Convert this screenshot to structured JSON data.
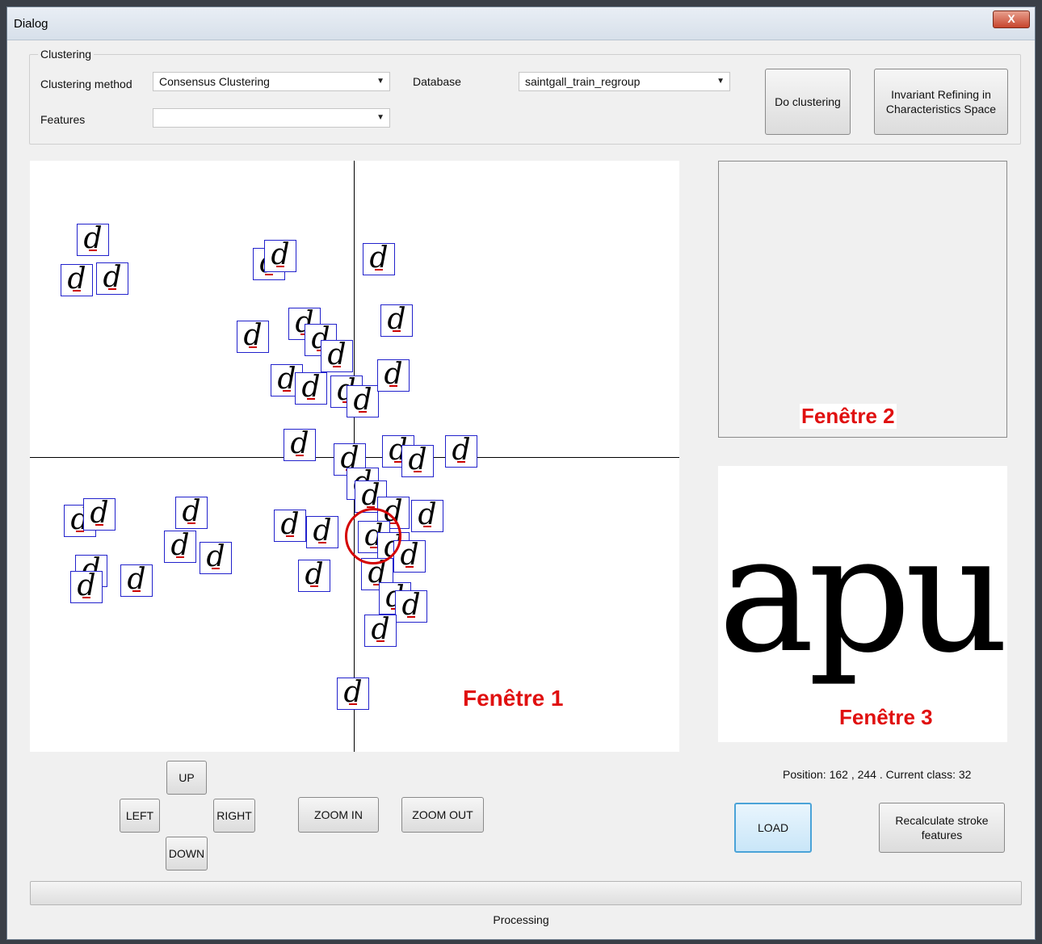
{
  "window": {
    "title": "Dialog",
    "close_label": "X"
  },
  "clustering": {
    "group_title": "Clustering",
    "method_label": "Clustering method",
    "method_value": "Consensus Clustering",
    "database_label": "Database",
    "database_value": "saintgall_train_regroup",
    "features_label": "Features",
    "features_value": "",
    "do_clustering_label": "Do clustering",
    "invariant_label": "Invariant Refining in Characteristics Space"
  },
  "views": {
    "window1_tag": "Fenêtre 1",
    "window2_tag": "Fenêtre 2",
    "window3_tag": "Fenêtre 3",
    "sample_word": "apu",
    "sample_word_highlight": "d",
    "glyph_char": "d"
  },
  "navigation": {
    "up": "UP",
    "left": "LEFT",
    "right": "RIGHT",
    "down": "DOWN",
    "zoom_in": "ZOOM IN",
    "zoom_out": "ZOOM OUT"
  },
  "status": {
    "position_text": "Position: 162 , 244 . Current class: 32",
    "load_label": "LOAD",
    "recalc_label": "Recalculate stroke features",
    "processing_text": "Processing",
    "progress": 0
  },
  "colors": {
    "accent_red": "#e01010",
    "glyph_border": "#2222cc",
    "highlight_blue": "#0000ee"
  }
}
